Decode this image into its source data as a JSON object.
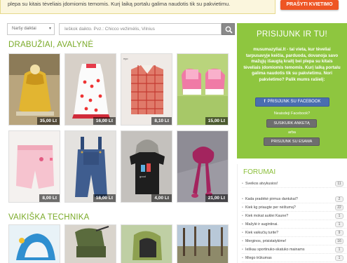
{
  "banner": {
    "text": "musumazyliai.lt - tai vieta, kur tėveliai tarpusavyje keičia, parduoda, dovanoja savo mažųjų išaugtą kraitį bei plepa su kitais tėveliais įdomiomis temomis. Kurį laiką portalu galima naudotis tik su pakvietimu.",
    "text_visible": "plepa su kitais tėveliais įdomiomis temomis. Kurį laiką portalu galima naudotis tik su pakvietimu.",
    "invite_button": "PRAŠYTI KVIETIMO"
  },
  "search": {
    "category": "Naršy daiktai",
    "placeholder": "Ieškok daikto. Pvz.: Chicco vežimėlis, Vilnius"
  },
  "sections": [
    {
      "title": "DRABUŽIAI, AVALYNĖ",
      "items": [
        {
          "price": "35,00 Lt",
          "desc": "yellow knit cape"
        },
        {
          "price": "16,00 Lt",
          "desc": "white polka dot dress"
        },
        {
          "price": "8,10 Lt",
          "desc": "red checked shirt"
        },
        {
          "price": "15,00 Lt",
          "desc": "pink sneakers"
        },
        {
          "price": "8,00 Lt",
          "desc": "pink shorts"
        },
        {
          "price": "18,00 Lt",
          "desc": "denim overalls"
        },
        {
          "price": "4,00 Lt",
          "desc": "black t-shirt"
        },
        {
          "price": "21,00 Lt",
          "desc": "knit hat and scarf"
        }
      ]
    },
    {
      "title": "VAIKIŠKA TECHNIKA",
      "items": [
        {
          "desc": "baby bouncer"
        },
        {
          "desc": "stroller"
        },
        {
          "desc": "car seat"
        },
        {
          "desc": "outdoor scene"
        }
      ]
    }
  ],
  "login": {
    "title": "PRISIJUNK IR TU!",
    "description": "musumazyliai.lt - tai vieta, kur tėveliai tarpusavyje keičia, parduoda, dovanoja savo mažųjų išaugtą kraitį bei plepa su kitais tėveliais įdomiomis temomis. Kurį laiką portalu galima naudotis tik su pakvietimu. Nori pakvietimo? Palik mums rašielį:",
    "facebook_button": "PRISIJUNK SU FACEBOOK",
    "no_facebook": "Neaisdeji Facebook?",
    "create_button": "SUSIKURK ANKETĄ",
    "or": "arba",
    "existing_button": "PRISIJUNK SU ESAMA"
  },
  "forum": {
    "title": "FORUMAI",
    "items": [
      {
        "label": "Sveikos atvykusios!",
        "count": "11"
      },
      {
        "label": "Kada pradėkė pirmus dantukai?",
        "count": "2"
      },
      {
        "label": "Kiek kg priaugte per nėštumą?",
        "count": "22"
      },
      {
        "label": "Kiek mokat auklei Kaune?",
        "count": "1"
      },
      {
        "label": "Mažylė ir augintinai.",
        "count": "1"
      },
      {
        "label": "Kiek vaikučių turite?",
        "count": "9"
      },
      {
        "label": "Merginos, prisistatykime!",
        "count": "16"
      },
      {
        "label": "Ieškau sportinuko-skatuko mainams",
        "count": "1"
      },
      {
        "label": "Miego trūkumas",
        "count": "1"
      }
    ]
  },
  "colors": {
    "accent_green": "#8ec63f",
    "section_title_green": "#7aaa28",
    "invite_orange": "#ee5524",
    "facebook_blue": "#4a6eb0"
  }
}
